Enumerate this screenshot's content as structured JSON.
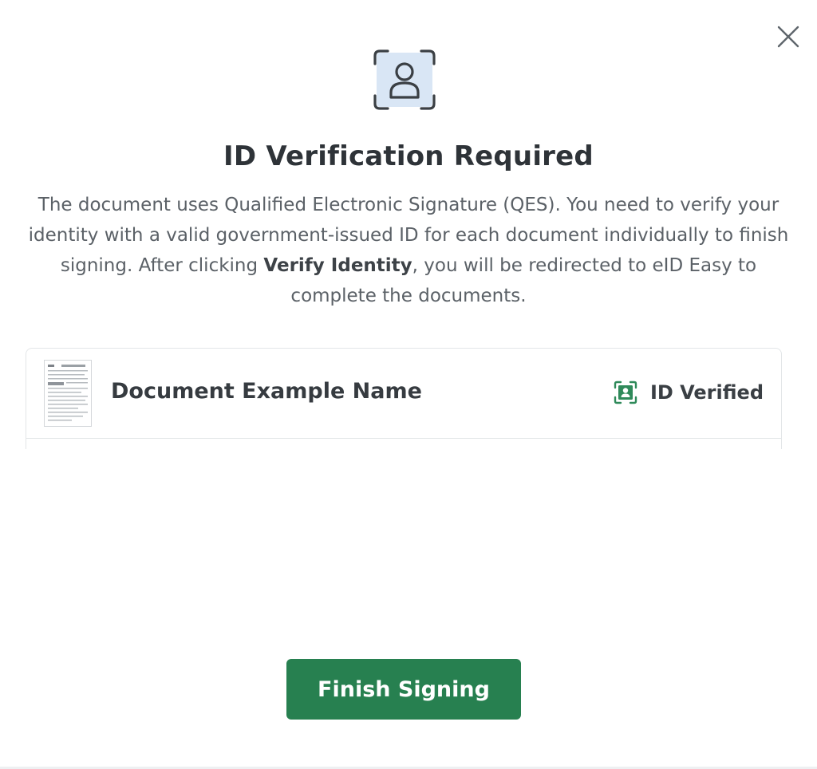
{
  "dialog": {
    "title": "ID Verification Required",
    "description_part1": "The document uses Qualified Electronic Signature (QES). You need to verify your identity with a valid government-issued ID for each document individually to finish signing. After clicking ",
    "description_bold": "Verify Identity",
    "description_part2": ", you will be redirected to eID Easy to complete the documents.",
    "hero_icon": "id-scan-icon",
    "close_icon": "close-icon"
  },
  "documents": [
    {
      "name": "Document Example Name",
      "status": "ID Verified",
      "status_icon": "id-verified-icon",
      "thumbnail_icon": "document-thumbnail"
    }
  ],
  "actions": {
    "finish_label": "Finish Signing"
  },
  "colors": {
    "accent": "#278050",
    "hero_bg": "#d9e6f5",
    "verified": "#2f8a5a"
  }
}
